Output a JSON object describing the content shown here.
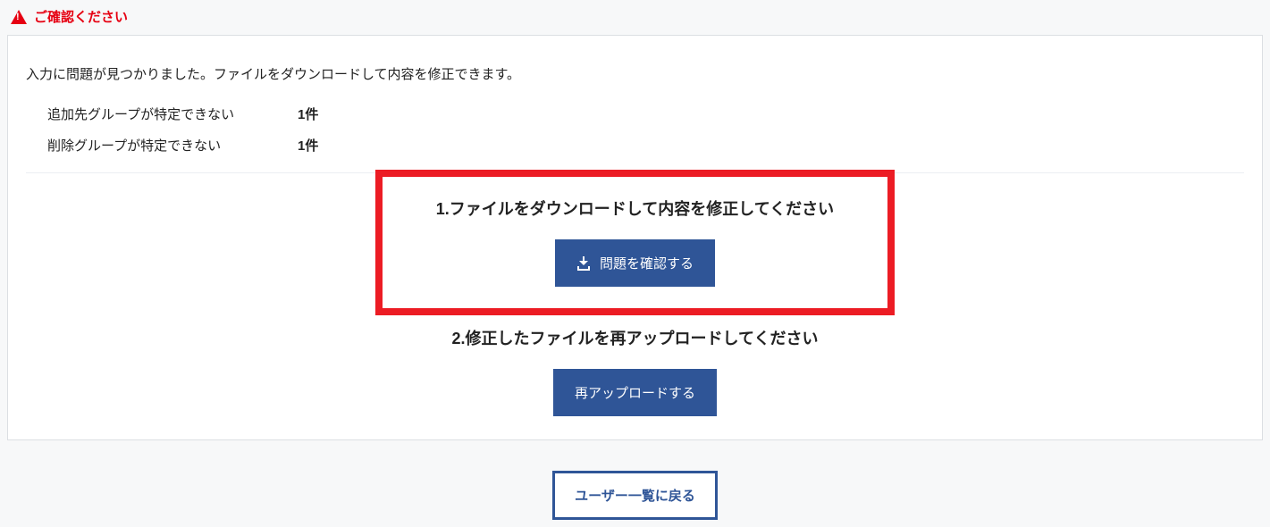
{
  "alert": {
    "title": "ご確認ください"
  },
  "panel": {
    "intro": "入力に問題が見つかりました。ファイルをダウンロードして内容を修正できます。",
    "errors": [
      {
        "label": "追加先グループが特定できない",
        "count": "1件"
      },
      {
        "label": "削除グループが特定できない",
        "count": "1件"
      }
    ],
    "step1": {
      "heading": "1.ファイルをダウンロードして内容を修正してください",
      "button": "問題を確認する"
    },
    "step2": {
      "heading": "2.修正したファイルを再アップロードしてください",
      "button": "再アップロードする"
    }
  },
  "footer": {
    "back_button": "ユーザー一覧に戻る"
  },
  "colors": {
    "accent": "#2f5597",
    "danger": "#e60012",
    "highlight_border": "#ec1c24"
  }
}
